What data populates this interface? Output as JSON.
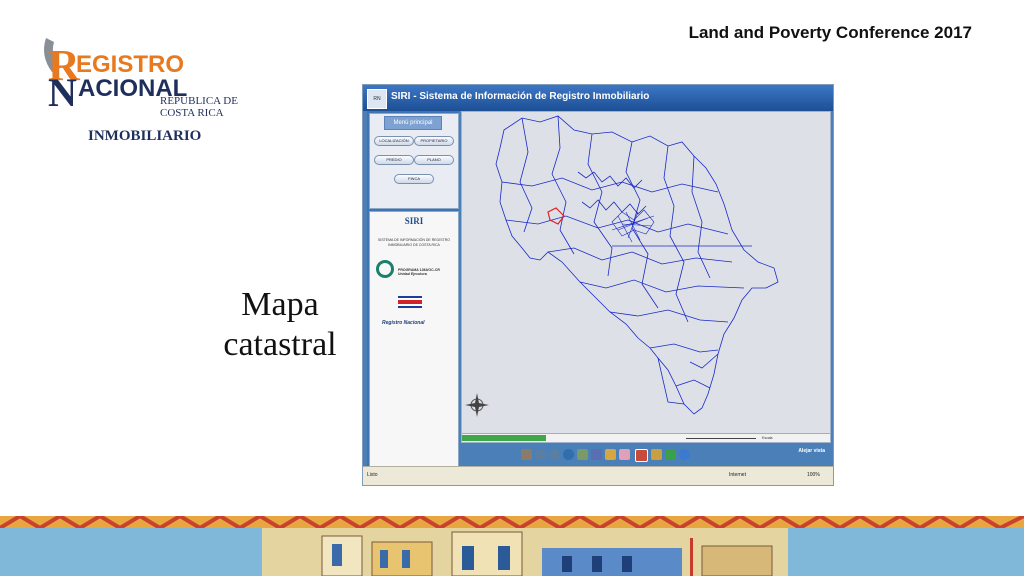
{
  "header": {
    "conference": "Land and Poverty Conference 2017"
  },
  "logo": {
    "line1": "REGISTRO",
    "line2": "NACIONAL",
    "republica": "REPÚBLICA DE",
    "country": "COSTA RICA",
    "section": "INMOBILIARIO",
    "colors": {
      "orange": "#e8791e",
      "navy": "#1f2f5c",
      "gray": "#8a8e96"
    }
  },
  "slide_label": {
    "line1": "Mapa",
    "line2": "catastral"
  },
  "app": {
    "title": "SIRI - Sistema de Información de Registro Inmobiliario",
    "menu": {
      "heading": "Menú principal",
      "buttons": [
        "LOCALIZACIÓN",
        "PROPIETARIO",
        "PREDIO",
        "PLANO",
        "FINCA"
      ]
    },
    "info": {
      "name": "SIRI",
      "subtitle": "SISTEMA DE INFORMACIÓN DE REGISTRO INMOBILIARIO DE COSTA RICA",
      "program": "PROGRAMA 1284/OC-CR",
      "program_sub": "Unidad Ejecutora",
      "registro": "Registro Nacional"
    },
    "scale_label": "Escala",
    "zoom_out_label": "Alejar vista",
    "status": {
      "left": "Listo",
      "zone": "Internet",
      "zoom": "100%"
    },
    "tool_icons": [
      "hand-icon",
      "zoom-in-icon",
      "zoom-out-icon",
      "globe-icon",
      "move-icon",
      "info-icon",
      "measure-icon",
      "eraser-icon",
      "select-icon",
      "layers-icon",
      "export-icon",
      "help-icon"
    ],
    "colors": {
      "window_blue": "#4a7fb8",
      "map_lines": "#1a28c8",
      "highlight": "#e02020"
    }
  }
}
